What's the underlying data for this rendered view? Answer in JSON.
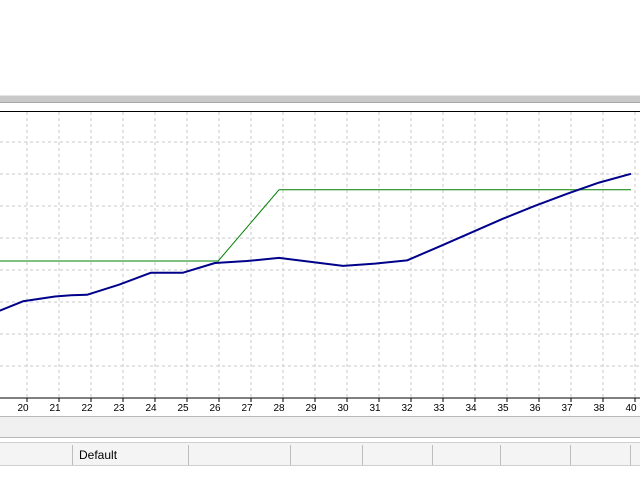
{
  "status_bar": {
    "cells": [
      "",
      "Default",
      "",
      "",
      "",
      "",
      "",
      "",
      ""
    ]
  },
  "colors": {
    "series_main": "#00008b",
    "series_step": "#008000",
    "grid": "#c8c8c8"
  },
  "chart_data": {
    "type": "line",
    "x_tick_labels": [
      "20",
      "21",
      "22",
      "23",
      "24",
      "25",
      "26",
      "27",
      "28",
      "29",
      "30",
      "31",
      "32",
      "33",
      "34",
      "35",
      "36",
      "37",
      "38",
      "40"
    ],
    "grid": true,
    "series": [
      {
        "color": "#00008b",
        "x": [
          19,
          20,
          21,
          21.5,
          22,
          23,
          24,
          25,
          26,
          27,
          28,
          29,
          30,
          31,
          32,
          33,
          34,
          35,
          36,
          37,
          38,
          39
        ],
        "y": [
          29.3,
          33.8,
          35.5,
          35.9,
          36.1,
          39.6,
          43.8,
          43.8,
          47.2,
          47.9,
          49,
          47.6,
          46.2,
          47.0,
          48.1,
          52.9,
          57.8,
          62.7,
          67.2,
          71.4,
          75.3,
          78.4
        ]
      },
      {
        "color": "#008000",
        "x": [
          19,
          26.1,
          28,
          39
        ],
        "y": [
          47.9,
          47.9,
          72.8,
          72.8
        ]
      }
    ]
  }
}
